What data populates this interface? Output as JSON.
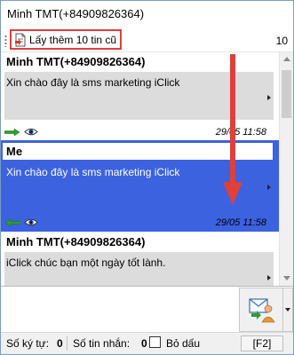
{
  "window": {
    "title": "Minh TMT(+84909826364)"
  },
  "toolbar": {
    "load_more_label": "Lấy thêm 10 tin cũ",
    "page_count": "10"
  },
  "messages": [
    {
      "sender": "Minh TMT(+84909826364)",
      "text": "Xin chào đây là sms marketing iClick",
      "time": "29/05 11:58",
      "direction": "incoming",
      "icon": "arrow-right-icon"
    },
    {
      "sender": "Me",
      "text": "Xin chào đây là sms marketing iClick",
      "time": "29/05 11:58",
      "direction": "outgoing",
      "icon": "arrow-left-icon",
      "selected": true
    },
    {
      "sender": "Minh TMT(+84909826364)",
      "text": "iClick chúc bạn một ngày tốt lành.",
      "direction": "incoming"
    }
  ],
  "compose": {
    "value": "",
    "send_shortcut": "[F2]"
  },
  "status": {
    "char_count_label": "Số ký tự:",
    "char_count": "0",
    "msg_count_label": "Số tin nhắn:",
    "msg_count": "0",
    "remove_accents_label": "Bỏ dấu",
    "remove_accents_checked": false
  },
  "colors": {
    "selection": "#3c62e0",
    "bubble": "#dcdcdc",
    "annotation": "#e0403a",
    "arrow_icon": "#2e9e2e"
  }
}
